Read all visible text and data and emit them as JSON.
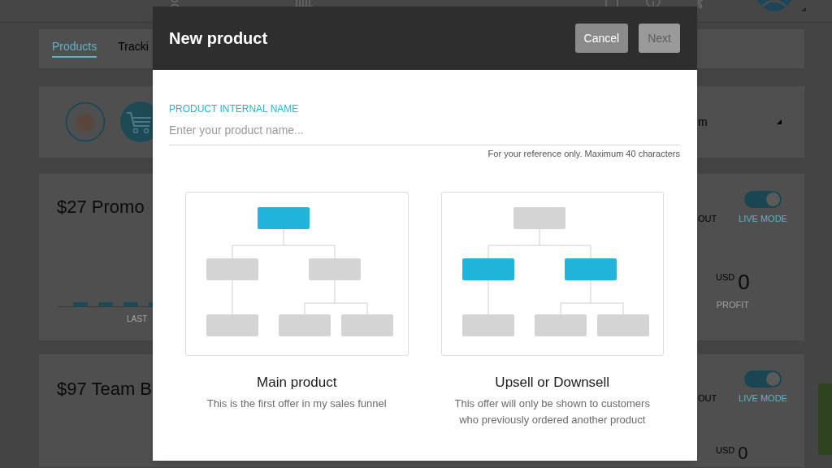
{
  "background": {
    "tabs": [
      {
        "label": "Products",
        "selected": true
      },
      {
        "label": "Tracki",
        "selected": false
      }
    ],
    "dropdown": {
      "value": "m"
    },
    "products": [
      {
        "title": "$27 Promo",
        "chart_label": "LAST",
        "status_label": "OUT",
        "live_mode": {
          "label": "LIVE MODE",
          "on": true
        },
        "currency": "USD",
        "profit": "0",
        "profit_label": "PROFIT"
      },
      {
        "title": "$97 Team B",
        "status_label": "OUT",
        "live_mode": {
          "label": "LIVE MODE",
          "on": true
        },
        "currency": "USD",
        "profit": "0"
      }
    ]
  },
  "dialog": {
    "title": "New product",
    "buttons": [
      {
        "label": "Cancel",
        "disabled": false
      },
      {
        "label": "Next",
        "disabled": true
      }
    ],
    "field": {
      "label": "PRODUCT INTERNAL NAME",
      "placeholder": "Enter your product name...",
      "hint": "For your reference only. Maximum 40 characters"
    },
    "options": [
      {
        "kind": "main",
        "title": "Main product",
        "description": "This is the first offer in my sales funnel"
      },
      {
        "kind": "upsell",
        "title": "Upsell or Downsell",
        "description": "This offer will only be shown to customers who previously ordered another product"
      }
    ]
  }
}
